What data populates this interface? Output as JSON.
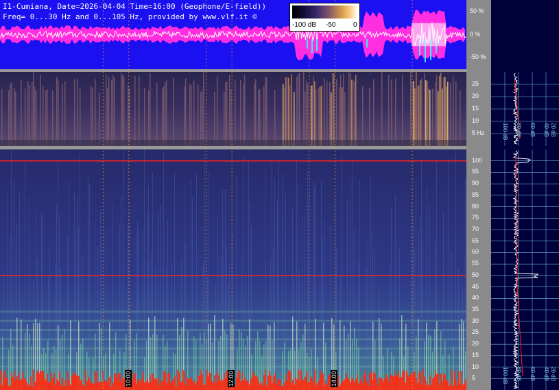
{
  "header": {
    "line1": "I1-Cumiana, Date=2026-04-04 Time=16:00 (Geophone/E-field))",
    "line2": "Freq= 0...30 Hz and 0...105 Hz, provided by www.vlf.it ©"
  },
  "color_scale": {
    "labels": [
      "-100 dB",
      "-50",
      "0"
    ]
  },
  "colors": {
    "waveform_bg": "#1a10f0",
    "waveform_envelope": "#ff2ee0",
    "waveform_signal": "#ffffff",
    "waveform_burst": "#30f0ff",
    "spectro_low_bg": "#2a2a6a",
    "spectro_high_bg": "#2e3680",
    "marker_line": "#ff2020",
    "grid": "#6fb8e0",
    "right_panel_bg": "#00003a"
  },
  "chart_data": [
    {
      "type": "line",
      "panel": "amplitude",
      "ytick_labels": [
        "50 %",
        "0 %",
        "-50 %"
      ],
      "ylim": [
        -75,
        75
      ]
    },
    {
      "type": "heatmap",
      "panel": "spectrogram 0-30 Hz",
      "ylim": [
        0,
        30
      ],
      "ytick_labels": [
        "25",
        "20",
        "15",
        "10",
        "5 Hz"
      ],
      "yticks": [
        25,
        20,
        15,
        10,
        5
      ],
      "profile_axis_labels": [
        "100 dB",
        "80 dB",
        "60 dB",
        "40 dB",
        "20 dB"
      ]
    },
    {
      "type": "heatmap",
      "panel": "spectrogram 0-105 Hz",
      "ylim": [
        0,
        105
      ],
      "ytick_labels": [
        "100",
        "95",
        "90",
        "85",
        "80",
        "75",
        "70",
        "65",
        "60",
        "55",
        "50",
        "45",
        "40",
        "35",
        "30",
        "25",
        "20",
        "15",
        "10",
        "5"
      ],
      "yticks": [
        100,
        95,
        90,
        85,
        80,
        75,
        70,
        65,
        60,
        55,
        50,
        45,
        40,
        35,
        30,
        25,
        20,
        15,
        10,
        5
      ],
      "profile_axis_labels": [
        "100 dB",
        "80 dB",
        "60 dB",
        "40 dB",
        "20 dB"
      ],
      "horizontal_lines_hz": [
        100,
        50
      ],
      "time_labels": [
        "10:00",
        "12:00",
        "14:00"
      ],
      "time_marker_hours": [
        9.5,
        10,
        11.5,
        12,
        13.5,
        14,
        15.5
      ]
    }
  ]
}
